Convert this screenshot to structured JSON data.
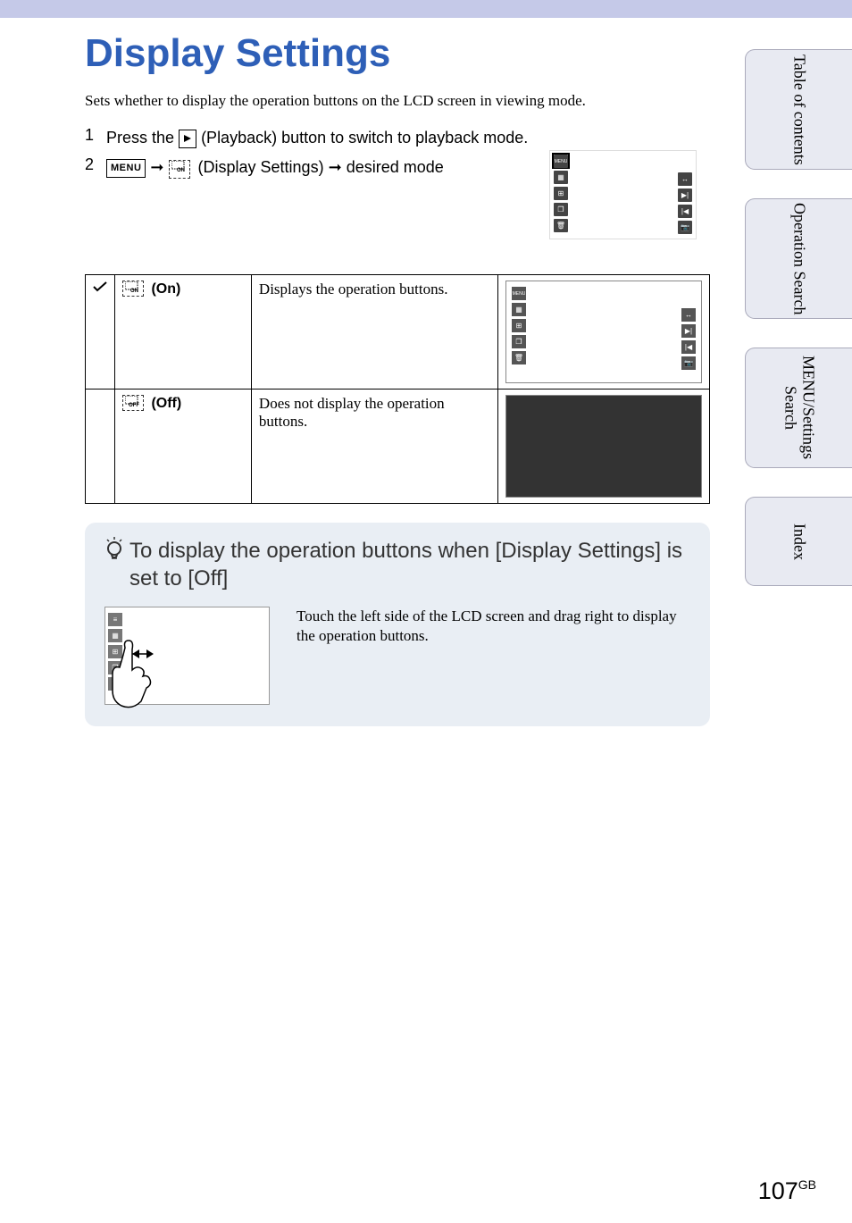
{
  "title": "Display Settings",
  "intro": "Sets whether to display the operation buttons on the LCD screen in viewing mode.",
  "steps": {
    "s1": {
      "num": "1",
      "pre": "Press the ",
      "post": " (Playback) button to switch to playback mode."
    },
    "s2": {
      "num": "2",
      "menu": "MENU",
      "mid": " (Display Settings) ",
      "post": " desired mode"
    }
  },
  "table": {
    "on": {
      "icon": "ON",
      "label": "(On)",
      "desc": "Displays the operation buttons."
    },
    "off": {
      "icon": "OFF",
      "label": "(Off)",
      "desc": "Does not display the operation buttons."
    }
  },
  "tip": {
    "title": "To display the operation buttons when [Display Settings] is set to [Off]",
    "body": "Touch the left side of the LCD screen and drag right to display the operation buttons."
  },
  "tabs": {
    "toc": "Table of contents",
    "op": "Operation Search",
    "menu": "MENU/Settings Search",
    "index": "Index"
  },
  "page": {
    "num": "107",
    "region": "GB"
  },
  "icons": {
    "menu": "MENU",
    "check": "✓"
  }
}
